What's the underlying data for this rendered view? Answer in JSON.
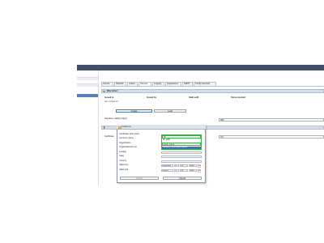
{
  "tabs": [
    {
      "label": "Access"
    },
    {
      "label": "Network"
    },
    {
      "label": "Crates"
    },
    {
      "label": "Security"
    },
    {
      "label": "Logging"
    },
    {
      "label": "Appearance"
    },
    {
      "label": "SMVP"
    },
    {
      "label": "Config Services"
    }
  ],
  "section1": {
    "title": "Mfg vnCert",
    "columns": [
      "Issued to",
      "Issued by",
      "Valid until",
      "Stores located"
    ],
    "empty_text": "Not configured",
    "create_label": "Create",
    "load_label": "Load",
    "validity_label": "Signature validity (days)",
    "validity_value": "365"
  },
  "section2": {
    "label": "Certificate",
    "value": "Off"
  },
  "dialog": {
    "title": "Create Ce",
    "fields": [
      {
        "label": "Certificate store (cert)"
      },
      {
        "label": "Common name"
      },
      {
        "label": "Organization"
      },
      {
        "label": "Organizational unit"
      },
      {
        "label": "Locality"
      },
      {
        "label": "State"
      },
      {
        "label": "Country"
      },
      {
        "label": "Valid from"
      },
      {
        "label": "Valid until"
      }
    ],
    "combo_options": [
      {
        "text": "IP"
      },
      {
        "text": "IP_addr"
      },
      {
        "text": "local_name"
      },
      {
        "text": "Subject_Alternative Name"
      }
    ],
    "valid_from": {
      "a": "Fernsehen",
      "b": "6",
      "c": "Jul",
      "d": "2018"
    },
    "valid_until": {
      "a": "Donner",
      "b": "5",
      "c": "Jul",
      "d": "2028"
    },
    "create_label": "Create",
    "cancel_label": "Cancel"
  },
  "colors": {
    "topbar": "#3f4e68",
    "selected_nav": "#5b7db8",
    "combo_border": "#3cb043",
    "combo_highlight": "#3a6fcf"
  }
}
